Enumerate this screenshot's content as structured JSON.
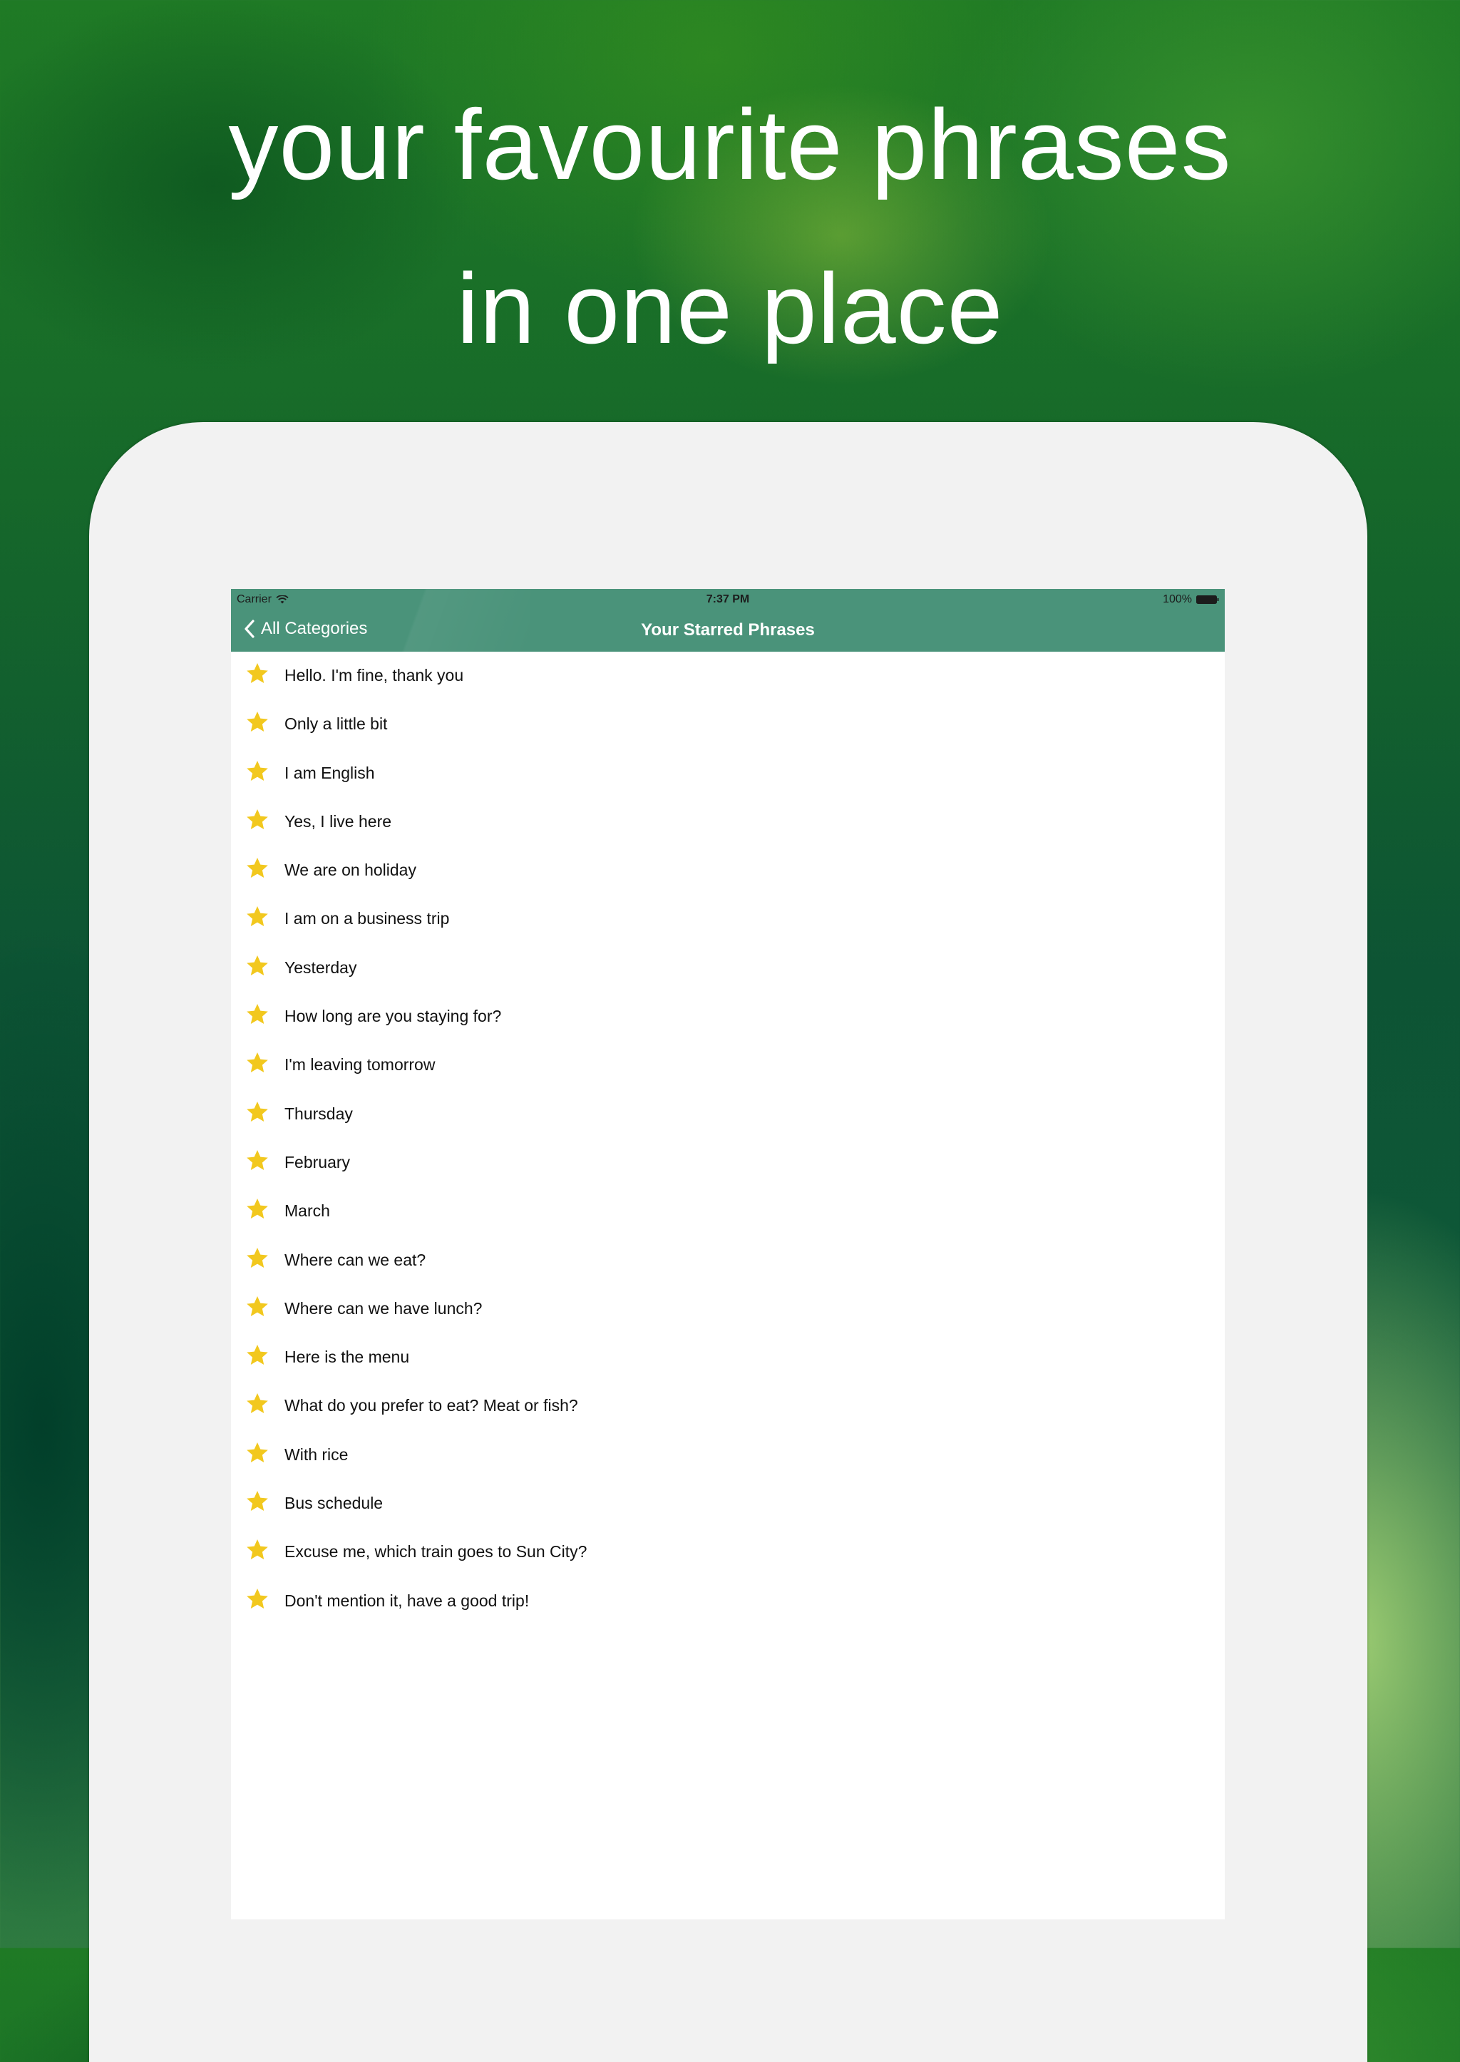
{
  "headline": {
    "line1": "your favourite phrases",
    "line2": "in one place"
  },
  "status_bar": {
    "carrier": "Carrier",
    "time": "7:37 PM",
    "battery": "100%"
  },
  "navbar": {
    "back_label": "All Categories",
    "title": "Your Starred Phrases"
  },
  "colors": {
    "navbar": "#4a937a",
    "star": "#f2c81e",
    "device_frame": "#f2f2f2"
  },
  "phrases": [
    "Hello. I'm fine, thank you",
    "Only a little bit",
    "I am English",
    "Yes, I live here",
    "We are on holiday",
    "I am on a business trip",
    "Yesterday",
    "How long are you staying for?",
    "I'm leaving tomorrow",
    "Thursday",
    "February",
    "March",
    "Where can we eat?",
    "Where can we have lunch?",
    "Here is the menu",
    "What do you prefer to eat? Meat or fish?",
    "With rice",
    "Bus schedule",
    "Excuse me, which train goes to Sun City?",
    "Don't mention it, have a good trip!"
  ]
}
